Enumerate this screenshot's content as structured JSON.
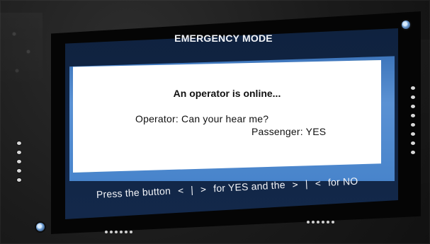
{
  "screen": {
    "title": "EMERGENCY MODE",
    "status_line": "An operator is online...",
    "dialog": {
      "operator": "Operator: Can your hear me?",
      "passenger": "Passenger: YES"
    },
    "instruction": {
      "prefix": "Press the button",
      "yes_symbol": "< | >",
      "middle": "for YES and the",
      "no_symbol": "> | <",
      "suffix": "for NO"
    }
  },
  "colors": {
    "background": "#2f6aa6",
    "screen": "#13284a",
    "panel": "#ffffff",
    "accent": "#4b89d2",
    "text_light": "#f2f4f8",
    "text_dark": "#111111"
  }
}
